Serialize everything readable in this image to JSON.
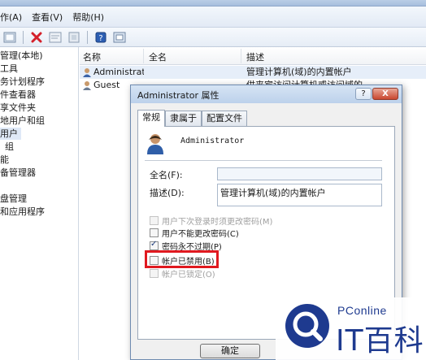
{
  "menubar": {
    "items": [
      "作(A)",
      "查看(V)",
      "帮助(H)"
    ]
  },
  "toolbar": {
    "icons": [
      "back-arrow-icon",
      "properties-icon",
      "delete-icon",
      "export-icon",
      "refresh-icon",
      "help-icon",
      "console-icon"
    ]
  },
  "tree": {
    "items": [
      "管理(本地)",
      "工具",
      "务计划程序",
      "件查看器",
      "享文件夹",
      "地用户和组",
      "用户",
      "组",
      "能",
      "备管理器",
      "盘管理",
      "和应用程序"
    ],
    "selected": "用户"
  },
  "list": {
    "columns": [
      "名称",
      "全名",
      "描述"
    ],
    "rows": [
      {
        "name": "Administrat...",
        "fullname": "",
        "description": "管理计算机(域)的内置帐户"
      },
      {
        "name": "Guest",
        "fullname": "",
        "description": "供来宾访问计算机或访问域的"
      }
    ]
  },
  "dialog": {
    "title": "Administrator 属性",
    "help_label": "?",
    "close_label": "X",
    "tabs": [
      "常规",
      "隶属于",
      "配置文件"
    ],
    "active_tab": "常规",
    "username": "Administrator",
    "fullname_label": "全名(F):",
    "fullname_value": "",
    "description_label": "描述(D):",
    "description_value": "管理计算机(域)的内置帐户",
    "checkboxes": [
      {
        "label": "用户下次登录时须更改密码(M)",
        "checked": false,
        "enabled": false
      },
      {
        "label": "用户不能更改密码(C)",
        "checked": false,
        "enabled": true
      },
      {
        "label": "密码永不过期(P)",
        "checked": true,
        "enabled": true
      },
      {
        "label": "帐户已禁用(B)",
        "checked": false,
        "enabled": true
      },
      {
        "label": "帐户已锁定(O)",
        "checked": false,
        "enabled": false
      }
    ],
    "ok_label": "确定"
  },
  "watermark": {
    "small": "PConline",
    "big": "IT百科"
  },
  "colors": {
    "highlight": "#e0191f",
    "brand": "#1e3a8f"
  }
}
